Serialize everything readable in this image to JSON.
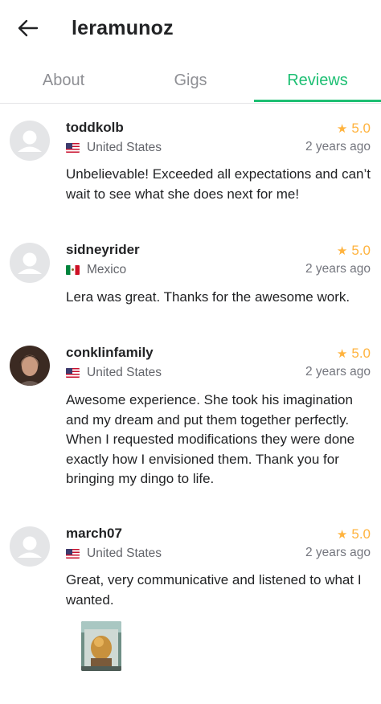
{
  "header": {
    "title": "leramunoz",
    "back_icon": "arrow-left-icon"
  },
  "tabs": [
    {
      "label": "About",
      "active": false
    },
    {
      "label": "Gigs",
      "active": false
    },
    {
      "label": "Reviews",
      "active": true
    }
  ],
  "colors": {
    "accent": "#1dbf73",
    "star": "#ffb33e",
    "text": "#222325",
    "muted": "#74767e"
  },
  "reviews": [
    {
      "username": "toddkolb",
      "country": "United States",
      "flag": "us-flag-icon",
      "rating": "5.0",
      "time": "2 years ago",
      "comment": "Unbelievable!  Exceeded all expectations and can’t wait to see what she does next for me!",
      "avatar": "default-avatar-icon"
    },
    {
      "username": "sidneyrider",
      "country": "Mexico",
      "flag": "mexico-flag-icon",
      "rating": "5.0",
      "time": "2 years ago",
      "comment": "Lera was great.  Thanks for the awesome work.",
      "avatar": "default-avatar-icon"
    },
    {
      "username": "conklinfamily",
      "country": "United States",
      "flag": "us-flag-icon",
      "rating": "5.0",
      "time": "2 years ago",
      "comment": "Awesome experience. She took his imagination and my dream and put them together perfectly. When I requested modifications they were done exactly how I envisioned them. Thank you for bringing my dingo to life.",
      "avatar": "user-photo"
    },
    {
      "username": "march07",
      "country": "United States",
      "flag": "us-flag-icon",
      "rating": "5.0",
      "time": "2 years ago",
      "comment": "Great, very communicative and listened to what I wanted.",
      "avatar": "default-avatar-icon",
      "attachment": "delivery-thumbnail"
    }
  ]
}
